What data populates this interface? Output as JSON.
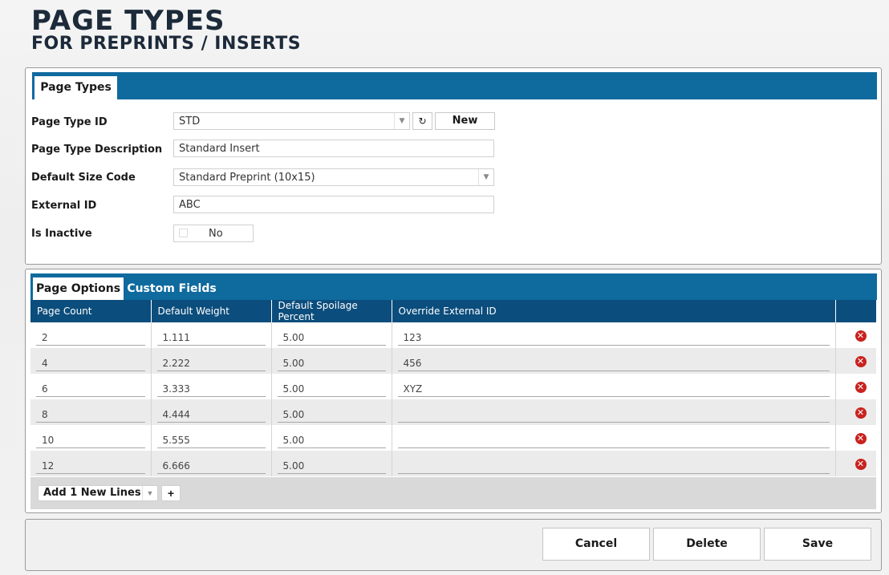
{
  "header": {
    "title": "PAGE TYPES",
    "subtitle": "FOR PREPRINTS / INSERTS"
  },
  "form_panel": {
    "tab_label": "Page Types",
    "fields": {
      "page_type_id": {
        "label": "Page Type ID",
        "value": "STD",
        "new_label": "New",
        "refresh_icon": "refresh-icon"
      },
      "description": {
        "label": "Page Type Description",
        "value": "Standard Insert"
      },
      "size_code": {
        "label": "Default Size Code",
        "value": "Standard Preprint (10x15)"
      },
      "external_id": {
        "label": "External ID",
        "value": "ABC"
      },
      "inactive": {
        "label": "Is Inactive",
        "value": "No"
      }
    }
  },
  "options_panel": {
    "tabs": [
      {
        "label": "Page Options",
        "active": true
      },
      {
        "label": "Custom Fields",
        "active": false
      }
    ],
    "columns": [
      "Page Count",
      "Default Weight",
      "Default Spoilage Percent",
      "Override External ID",
      ""
    ],
    "rows": [
      [
        "2",
        "1.111",
        "5.00",
        "123"
      ],
      [
        "4",
        "2.222",
        "5.00",
        "456"
      ],
      [
        "6",
        "3.333",
        "5.00",
        "XYZ"
      ],
      [
        "8",
        "4.444",
        "5.00",
        ""
      ],
      [
        "10",
        "5.555",
        "5.00",
        ""
      ],
      [
        "12",
        "6.666",
        "5.00",
        ""
      ]
    ],
    "add_lines_label": "Add 1 New Lines",
    "add_button": "+"
  },
  "actions": {
    "cancel": "Cancel",
    "delete": "Delete",
    "save": "Save"
  },
  "colors": {
    "tab_bar": "#0f6a9e",
    "grid_header": "#0b4d7c",
    "delete_icon": "#c8231f"
  }
}
